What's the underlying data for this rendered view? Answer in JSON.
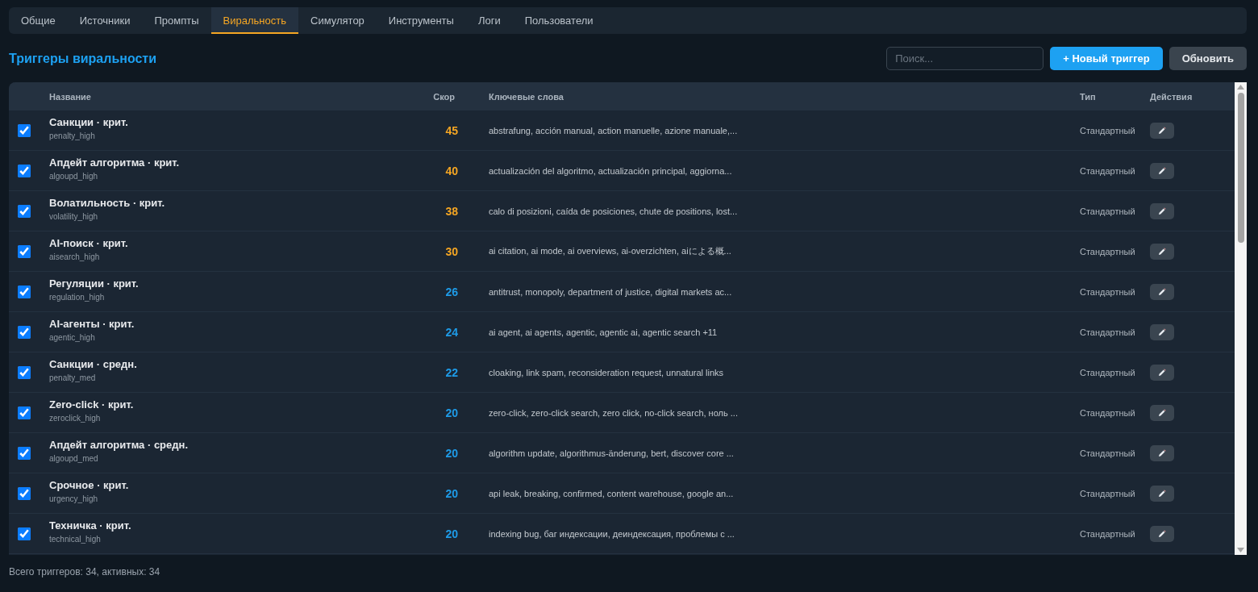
{
  "tabs": [
    {
      "label": "Общие",
      "selected": false
    },
    {
      "label": "Источники",
      "selected": false
    },
    {
      "label": "Промпты",
      "selected": false
    },
    {
      "label": "Виральность",
      "selected": true
    },
    {
      "label": "Симулятор",
      "selected": false
    },
    {
      "label": "Инструменты",
      "selected": false
    },
    {
      "label": "Логи",
      "selected": false
    },
    {
      "label": "Пользователи",
      "selected": false
    }
  ],
  "header": {
    "title": "Триггеры виральности",
    "search": {
      "placeholder": "Поиск..."
    },
    "buttons": [
      {
        "label": "+ Новый триггер",
        "kind": "primary"
      },
      {
        "label": "Обновить",
        "kind": "secondary"
      }
    ]
  },
  "table": {
    "columns": [
      "Название",
      "Скор",
      "Ключевые слова",
      "Тип",
      "Действия"
    ],
    "rows": [
      {
        "enabled": true,
        "name": "Санкции · крит.",
        "id": "penalty_high",
        "score": "45",
        "color": "#f5a623",
        "keywords": "abstrafung, acción manual, action manuelle, azione manuale,...",
        "type": "Стандартный"
      },
      {
        "enabled": true,
        "name": "Апдейт алгоритма · крит.",
        "id": "algoupd_high",
        "score": "40",
        "color": "#f5a623",
        "keywords": "actualización del algoritmo, actualización principal, aggiorna...",
        "type": "Стандартный"
      },
      {
        "enabled": true,
        "name": "Волатильность · крит.",
        "id": "volatility_high",
        "score": "38",
        "color": "#f5a623",
        "keywords": "calo di posizioni, caída de posiciones, chute de positions, lost...",
        "type": "Стандартный"
      },
      {
        "enabled": true,
        "name": "AI-поиск · крит.",
        "id": "aisearch_high",
        "score": "30",
        "color": "#f5a623",
        "keywords": "ai citation, ai mode, ai overviews, ai-overzichten, aiによる概...",
        "type": "Стандартный"
      },
      {
        "enabled": true,
        "name": "Регуляции · крит.",
        "id": "regulation_high",
        "score": "26",
        "color": "#1e9be8",
        "keywords": "antitrust, monopoly, department of justice, digital markets ac...",
        "type": "Стандартный"
      },
      {
        "enabled": true,
        "name": "AI-агенты · крит.",
        "id": "agentic_high",
        "score": "24",
        "color": "#1e9be8",
        "keywords": "ai agent, ai agents, agentic, agentic ai, agentic search +11",
        "type": "Стандартный"
      },
      {
        "enabled": true,
        "name": "Санкции · средн.",
        "id": "penalty_med",
        "score": "22",
        "color": "#1e9be8",
        "keywords": "cloaking, link spam, reconsideration request, unnatural links",
        "type": "Стандартный"
      },
      {
        "enabled": true,
        "name": "Zero-click · крит.",
        "id": "zeroclick_high",
        "score": "20",
        "color": "#1e9be8",
        "keywords": "zero-click, zero-click search, zero click, no-click search, ноль ...",
        "type": "Стандартный"
      },
      {
        "enabled": true,
        "name": "Апдейт алгоритма · средн.",
        "id": "algoupd_med",
        "score": "20",
        "color": "#1e9be8",
        "keywords": "algorithm update, algorithmus-änderung, bert, discover core ...",
        "type": "Стандартный"
      },
      {
        "enabled": true,
        "name": "Срочное · крит.",
        "id": "urgency_high",
        "score": "20",
        "color": "#1e9be8",
        "keywords": "api leak, breaking, confirmed, content warehouse, google an...",
        "type": "Стандартный"
      },
      {
        "enabled": true,
        "name": "Техничка · крит.",
        "id": "technical_high",
        "score": "20",
        "color": "#1e9be8",
        "keywords": "indexing bug, баг индексации, деиндексация, проблемы с ...",
        "type": "Стандартный"
      }
    ]
  },
  "footer": "Всего триггеров: 34, активных: 34"
}
